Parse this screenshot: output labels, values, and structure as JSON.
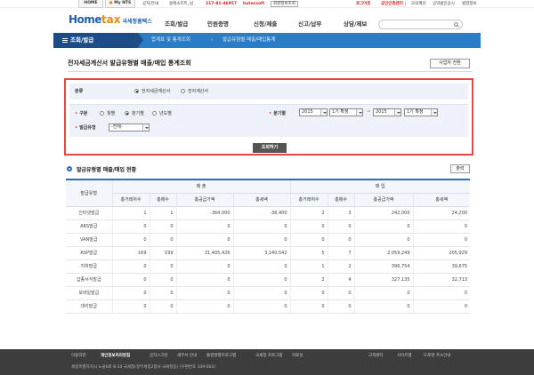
{
  "topbar": {
    "home": "HOME",
    "my_nts": "My NTS",
    "notice": "공지/안내",
    "user": "송택소프트_님",
    "phone": "217-81-46957",
    "company": "hutecsoft",
    "member_info": "회원정보조회",
    "logout": "로그아웃",
    "cert_center": "공인인증센터",
    "links": [
      "모의계산",
      "공익법인공시",
      "법령정보"
    ]
  },
  "header": {
    "logo_home": "Home",
    "logo_tax": "tax",
    "logo_kr": "국세청홈택스",
    "menu": [
      "조회/발급",
      "민원증명",
      "신청/제출",
      "신고/납부",
      "상담/제보"
    ],
    "search_placeholder": ""
  },
  "breadcrumb": {
    "menu_label": "조회/발급",
    "items": [
      "합계표 및 통계조회",
      "발급유형별 매출/매입통계"
    ]
  },
  "page": {
    "title": "전자세금계산서 발급유형별 매출/매입 통계조회",
    "switch_button": "사업자 전환"
  },
  "filter": {
    "category_label": "분류",
    "category_options": [
      "전자세금계산서",
      "전자계산서"
    ],
    "category_selected": 0,
    "period_label": "구분",
    "period_options": [
      "월별",
      "분기별",
      "년도별"
    ],
    "period_selected": 1,
    "quarter_label": "분기별",
    "from_year": "2015",
    "from_quarter": "1기 확정",
    "range_sep": "~",
    "to_year": "2015",
    "to_quarter": "1기 확정",
    "issue_type_label": "발급유형",
    "issue_type_value": "-전체-",
    "search_button": "조회하기"
  },
  "section": {
    "title": "발급유형별 매출/매입 현황",
    "export_button": "출력"
  },
  "table": {
    "row_header": "발급유형",
    "group_sales": "매 출",
    "group_purchase": "매 입",
    "columns": [
      "총거래처수",
      "총매수",
      "총공급가액",
      "총세액",
      "총거래처수",
      "총매수",
      "총공급가액",
      "총세액"
    ],
    "rows": [
      {
        "type": "인터넷발급",
        "v": [
          "1",
          "1",
          "-364,000",
          "-36,400",
          "2",
          "3",
          "242,000",
          "24,200"
        ]
      },
      {
        "type": "ARS발급",
        "v": [
          "0",
          "0",
          "0",
          "0",
          "0",
          "0",
          "0",
          "0"
        ]
      },
      {
        "type": "VAN발급",
        "v": [
          "0",
          "0",
          "0",
          "0",
          "0",
          "0",
          "0",
          "0"
        ]
      },
      {
        "type": "ASP발급",
        "v": [
          "169",
          "199",
          "31,405,426",
          "3,140,542",
          "5",
          "7",
          "2,059,249",
          "205,929"
        ]
      },
      {
        "type": "지하발급",
        "v": [
          "0",
          "0",
          "0",
          "0",
          "1",
          "2",
          "396,754",
          "39,675"
        ]
      },
      {
        "type": "갑종서식발급",
        "v": [
          "0",
          "0",
          "0",
          "0",
          "2",
          "4",
          "327,135",
          "32,713"
        ]
      },
      {
        "type": "모바일발급",
        "v": [
          "0",
          "0",
          "0",
          "0",
          "0",
          "0",
          "0",
          "0"
        ]
      },
      {
        "type": "대리발급",
        "v": [
          "0",
          "0",
          "0",
          "0",
          "0",
          "0",
          "0",
          "0"
        ]
      }
    ]
  },
  "footer": {
    "nav": [
      "이용약관",
      "개인정보처리방침",
      "글자스크린",
      "세무서 안내",
      "통합발행프로그램",
      "국세청 프로그램",
      "자료실"
    ],
    "right_nav": [
      "고객센터",
      "사이트맵",
      "도로명 주소안내"
    ],
    "address": "세종특별자치시 노을6로 8-14 국세청(정부세종2청사 국세청동) (우편번호 339-003)"
  },
  "colors": {
    "brand_blue": "#2a7cc7",
    "dark_blue": "#1e4c86",
    "highlight_red": "#e24848",
    "footer_bg": "#3d3d3d"
  }
}
